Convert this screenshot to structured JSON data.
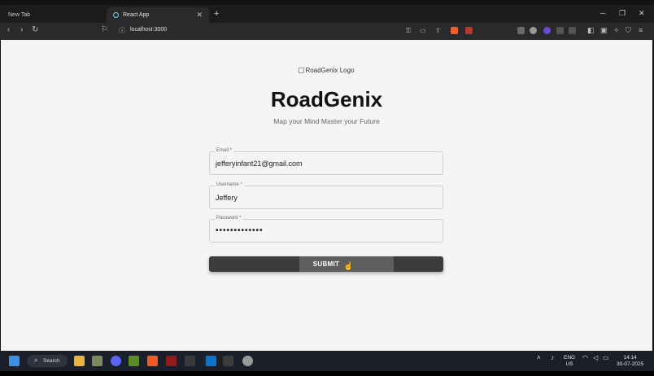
{
  "browser": {
    "tabs": [
      {
        "label": "New Tab"
      },
      {
        "label": "React App"
      }
    ],
    "new_tab_glyph": "+",
    "url": "localhost:3000",
    "window_controls": {
      "minimize": "─",
      "restore": "❐",
      "close": "✕"
    }
  },
  "page": {
    "logo_alt": "RoadGenix Logo",
    "title": "RoadGenix",
    "tagline": "Map your Mind Master your Future",
    "form": {
      "email": {
        "label": "Email *",
        "value": "jefferyinfant21@gmail.com"
      },
      "username": {
        "label": "Username *",
        "value": "Jeffery"
      },
      "password": {
        "label": "Password *",
        "value": "•••••••••••••"
      },
      "submit_label": "SUBMIT"
    }
  },
  "taskbar": {
    "search_label": "Search",
    "language": "ENG",
    "region": "US",
    "time": "14:14",
    "date": "30-07-2025"
  },
  "colors": {
    "accent_button": "#3c3c3c",
    "page_background": "#f4f4f4",
    "title_text": "#111111"
  }
}
